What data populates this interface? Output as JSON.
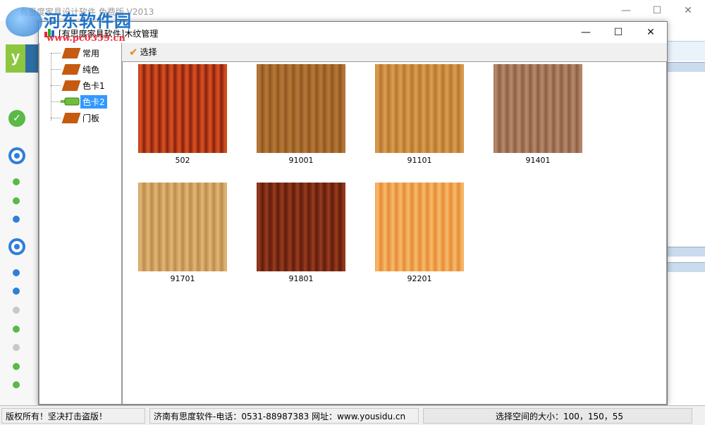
{
  "main_window": {
    "title": "有思度家具设计软件 免费版 V2013",
    "win_controls": {
      "minimize": "—",
      "maximize": "☐",
      "close": "✕"
    }
  },
  "watermark": {
    "site_name": "河东软件园",
    "url": "www.pc0359.cn"
  },
  "dialog": {
    "title": "[有思度家具软件]木纹管理",
    "controls": {
      "minimize": "—",
      "maximize": "☐",
      "close": "✕"
    },
    "toolbar": {
      "select_label": "选择"
    },
    "tree": {
      "items": [
        {
          "label": "常用",
          "selected": false
        },
        {
          "label": "纯色",
          "selected": false
        },
        {
          "label": "色卡1",
          "selected": false
        },
        {
          "label": "色卡2",
          "selected": true
        },
        {
          "label": "门板",
          "selected": false
        }
      ]
    },
    "swatches": [
      {
        "code": "502",
        "colors": [
          "#b8391a",
          "#d8541e",
          "#7e200f"
        ]
      },
      {
        "code": "91001",
        "colors": [
          "#a66a2b",
          "#b8793a",
          "#8a5420"
        ]
      },
      {
        "code": "91101",
        "colors": [
          "#c98a3f",
          "#daa050",
          "#b57530"
        ]
      },
      {
        "code": "91401",
        "colors": [
          "#a27458",
          "#b98b6c",
          "#8a5c42"
        ]
      },
      {
        "code": "91701",
        "colors": [
          "#cfa060",
          "#e0b878",
          "#bb8a48"
        ]
      },
      {
        "code": "91801",
        "colors": [
          "#7a2a14",
          "#9b3d1e",
          "#5e1c0c"
        ]
      },
      {
        "code": "92201",
        "colors": [
          "#f0a24e",
          "#f6bb70",
          "#e48a34"
        ]
      }
    ]
  },
  "statusbar": {
    "left": "版权所有！坚决打击盗版！",
    "middle": "济南有思度软件-电话：0531-88987383 网址：www.yousidu.cn",
    "right": "选择空间的大小：100，150，55"
  },
  "accent_colors": {
    "selection": "#3399ff",
    "step_done": "#5ab947",
    "step_current": "#2f7fd8",
    "step_pending": "#c8c8c8",
    "tree_icon": "#c55a11"
  }
}
